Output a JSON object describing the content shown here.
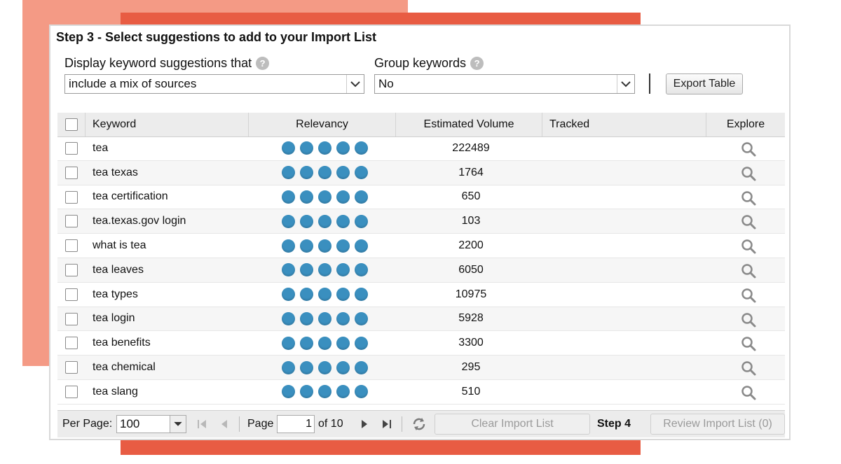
{
  "step3": {
    "title": "Step 3 - Select suggestions to add to your Import List"
  },
  "controls": {
    "display_label": "Display keyword suggestions that",
    "display_value": "include a mix of sources",
    "group_label": "Group keywords",
    "group_value": "No",
    "help_glyph": "?",
    "export_label": "Export Table"
  },
  "table": {
    "columns": [
      "Keyword",
      "Relevancy",
      "Estimated Volume",
      "Tracked",
      "Explore"
    ],
    "rows": [
      {
        "keyword": "tea",
        "relevancy": 5,
        "volume": "222489"
      },
      {
        "keyword": "tea texas",
        "relevancy": 5,
        "volume": "1764"
      },
      {
        "keyword": "tea certification",
        "relevancy": 5,
        "volume": "650"
      },
      {
        "keyword": "tea.texas.gov login",
        "relevancy": 5,
        "volume": "103"
      },
      {
        "keyword": "what is tea",
        "relevancy": 5,
        "volume": "2200"
      },
      {
        "keyword": "tea leaves",
        "relevancy": 5,
        "volume": "6050"
      },
      {
        "keyword": "tea types",
        "relevancy": 5,
        "volume": "10975"
      },
      {
        "keyword": "tea login",
        "relevancy": 5,
        "volume": "5928"
      },
      {
        "keyword": "tea benefits",
        "relevancy": 5,
        "volume": "3300"
      },
      {
        "keyword": "tea chemical",
        "relevancy": 5,
        "volume": "295"
      },
      {
        "keyword": "tea slang",
        "relevancy": 5,
        "volume": "510"
      }
    ]
  },
  "footer": {
    "per_page_label": "Per Page:",
    "per_page_value": "100",
    "page_label": "Page",
    "page_value": "1",
    "of_pages": "of 10",
    "clear_label": "Clear Import List",
    "step4_label": "Step 4",
    "review_label": "Review Import List (0)"
  },
  "colors": {
    "accent_dark": "#e85c43",
    "accent_light": "#f49a85",
    "relevancy_dot": "#3a8fbf"
  },
  "icons": [
    "help-icon",
    "chevron-down-icon",
    "search-icon",
    "first-page-icon",
    "prev-page-icon",
    "next-page-icon",
    "last-page-icon",
    "refresh-icon"
  ]
}
